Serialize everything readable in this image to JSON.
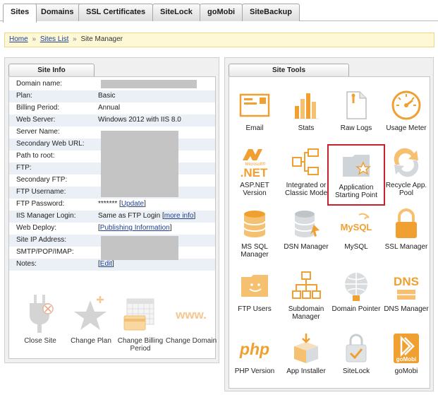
{
  "tabs": [
    "Sites",
    "Domains",
    "SSL Certificates",
    "SiteLock",
    "goMobi",
    "SiteBackup"
  ],
  "active_tab": "Sites",
  "breadcrumb": {
    "home": "Home",
    "sites_list": "Sites List",
    "current": "Site Manager",
    "separator": "»"
  },
  "site_info": {
    "title": "Site Info",
    "rows": [
      {
        "label": "Domain name:",
        "value": ""
      },
      {
        "label": "Plan:",
        "value": "Basic"
      },
      {
        "label": "Billing Period:",
        "value": "Annual"
      },
      {
        "label": "Web Server:",
        "value": "Windows 2012 with IIS 8.0"
      },
      {
        "label": "Server Name:",
        "value": ""
      },
      {
        "label": "Secondary Web URL:",
        "value": ""
      },
      {
        "label": "Path to root:",
        "value": ""
      },
      {
        "label": "FTP:",
        "value": ""
      },
      {
        "label": "Secondary FTP:",
        "value": ""
      },
      {
        "label": "FTP Username:",
        "value": ""
      },
      {
        "label": "FTP Password:",
        "value": "*******",
        "link": "Update"
      },
      {
        "label": "IIS Manager Login:",
        "value": "Same as FTP Login",
        "link": "more info"
      },
      {
        "label": "Web Deploy:",
        "value": "",
        "link": "Publishing Information"
      },
      {
        "label": "Site IP Address:",
        "value": ""
      },
      {
        "label": "SMTP/POP/IMAP:",
        "value": ""
      },
      {
        "label": "Notes:",
        "value": "",
        "link": "Edit"
      }
    ],
    "actions": [
      {
        "label": "Close Site",
        "icon": "plug-close-icon"
      },
      {
        "label": "Change Plan",
        "icon": "star-plus-icon"
      },
      {
        "label": "Change Billing Period",
        "icon": "calendar-card-icon"
      },
      {
        "label": "Change Domain",
        "icon": "www-icon"
      }
    ]
  },
  "site_tools": {
    "title": "Site Tools",
    "selected": "Application Starting Point",
    "items": [
      {
        "label": "Email",
        "icon": "envelope-icon"
      },
      {
        "label": "Stats",
        "icon": "bar-chart-icon"
      },
      {
        "label": "Raw Logs",
        "icon": "document-icon"
      },
      {
        "label": "Usage Meter",
        "icon": "gauge-icon"
      },
      {
        "label": "ASP.NET Version",
        "icon": "dotnet-logo-icon",
        "logo_text": ".NET",
        "logo_sub": "Microsoft®"
      },
      {
        "label": "Integrated or Classic Mode",
        "icon": "flowchart-icon"
      },
      {
        "label": "Application Starting Point",
        "icon": "folder-star-icon"
      },
      {
        "label": "Recycle App. Pool",
        "icon": "recycle-icon"
      },
      {
        "label": "MS SQL Manager",
        "icon": "database-icon"
      },
      {
        "label": "DSN Manager",
        "icon": "database-grey-icon"
      },
      {
        "label": "MySQL",
        "icon": "mysql-logo-icon",
        "logo_text": "MySQL"
      },
      {
        "label": "SSL Manager",
        "icon": "padlock-icon"
      },
      {
        "label": "FTP Users",
        "icon": "folder-smile-icon"
      },
      {
        "label": "Subdomain Manager",
        "icon": "sitemap-icon"
      },
      {
        "label": "Domain Pointer",
        "icon": "globe-pointer-icon"
      },
      {
        "label": "DNS Manager",
        "icon": "dns-icon",
        "logo_text": "DNS"
      },
      {
        "label": "PHP Version",
        "icon": "php-logo-icon",
        "logo_text": "php"
      },
      {
        "label": "App Installer",
        "icon": "box-icon"
      },
      {
        "label": "SiteLock",
        "icon": "sitelock-icon"
      },
      {
        "label": "goMobi",
        "icon": "gomobi-icon",
        "logo_text": "goMobi"
      }
    ]
  },
  "colors": {
    "accent_orange": "#f0a030",
    "selected_border": "#c8202c",
    "link": "#1f3f8f",
    "breadcrumb_bg": "#fff8d6"
  }
}
